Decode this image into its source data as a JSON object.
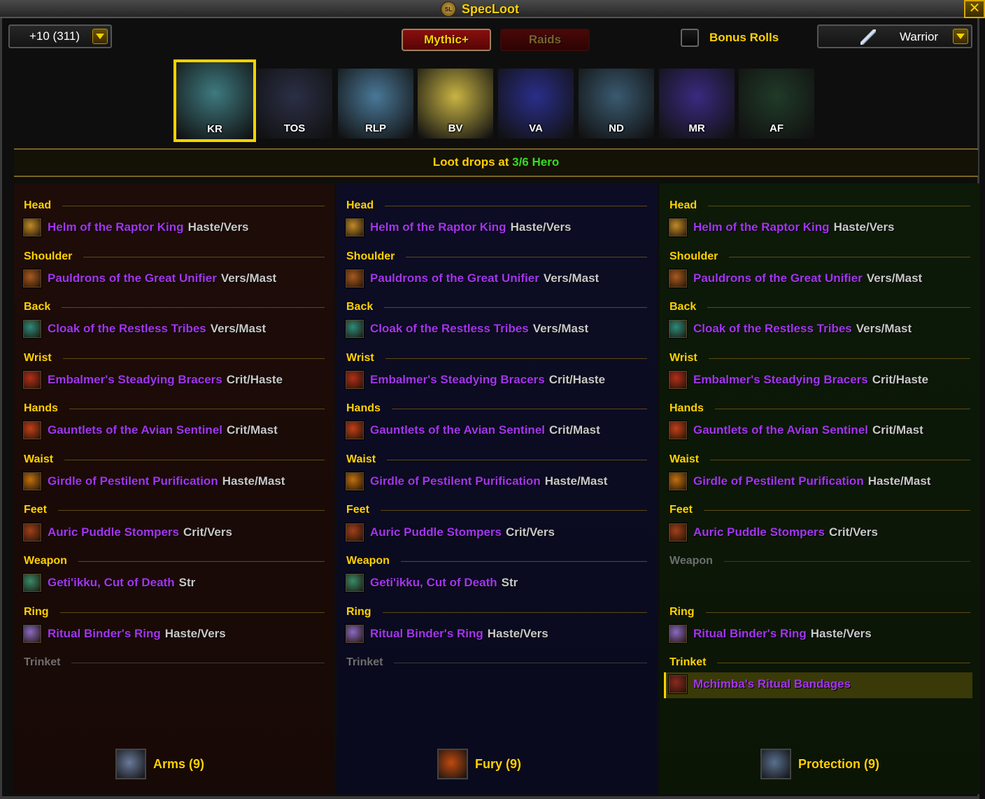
{
  "title": "SpecLoot",
  "title_icon_text": "SL",
  "close_label": "✕",
  "keystone_dropdown": {
    "value": "+10 (311)"
  },
  "tabs": [
    {
      "label": "Mythic+",
      "active": true
    },
    {
      "label": "Raids",
      "active": false
    }
  ],
  "bonus_rolls": {
    "label": "Bonus Rolls",
    "checked": false
  },
  "class_dropdown": {
    "value": "Warrior",
    "icon": "sword-icon"
  },
  "dungeons": [
    {
      "abbr": "KR",
      "selected": true,
      "color": "#3e7a80"
    },
    {
      "abbr": "TOS",
      "selected": false,
      "color": "#2b2f46"
    },
    {
      "abbr": "RLP",
      "selected": false,
      "color": "#4a7898"
    },
    {
      "abbr": "BV",
      "selected": false,
      "color": "#c9b443"
    },
    {
      "abbr": "VA",
      "selected": false,
      "color": "#2a2e8a"
    },
    {
      "abbr": "ND",
      "selected": false,
      "color": "#3a5a70"
    },
    {
      "abbr": "MR",
      "selected": false,
      "color": "#3a2a80"
    },
    {
      "abbr": "AF",
      "selected": false,
      "color": "#203a28"
    }
  ],
  "loot_drops": {
    "prefix": "Loot drops at",
    "level": "3/6 Hero"
  },
  "slot_labels": [
    "Head",
    "Shoulder",
    "Back",
    "Wrist",
    "Hands",
    "Waist",
    "Feet",
    "Weapon",
    "Ring",
    "Trinket"
  ],
  "items": [
    {
      "name": "Helm of the Raptor King",
      "stats": "Haste/Vers",
      "icon": "helm-icon",
      "color": "#c08a2a"
    },
    {
      "name": "Pauldrons of the Great Unifier",
      "stats": "Vers/Mast",
      "icon": "pauldrons-icon",
      "color": "#a85a20"
    },
    {
      "name": "Cloak of the Restless Tribes",
      "stats": "Vers/Mast",
      "icon": "cloak-icon",
      "color": "#2e8a7a"
    },
    {
      "name": "Embalmer's Steadying Bracers",
      "stats": "Crit/Haste",
      "icon": "bracers-icon",
      "color": "#b0301a"
    },
    {
      "name": "Gauntlets of the Avian Sentinel",
      "stats": "Crit/Mast",
      "icon": "gauntlets-icon",
      "color": "#c0401a"
    },
    {
      "name": "Girdle of Pestilent Purification",
      "stats": "Haste/Mast",
      "icon": "girdle-icon",
      "color": "#c07010"
    },
    {
      "name": "Auric Puddle Stompers",
      "stats": "Crit/Vers",
      "icon": "boots-icon",
      "color": "#a0401a"
    },
    {
      "name": "Geti'ikku, Cut of Death",
      "stats": "Str",
      "icon": "weapon-icon",
      "color": "#3a8a6a"
    },
    {
      "name": "Ritual Binder's Ring",
      "stats": "Haste/Vers",
      "icon": "ring-icon",
      "color": "#8a6ac0"
    },
    {
      "name": "Mchimba's Ritual Bandages",
      "stats": "",
      "icon": "bandages-icon",
      "color": "#8a2a20"
    }
  ],
  "specs": [
    {
      "name": "Arms",
      "label": "Arms (9)",
      "icon": "arms-icon",
      "accent": "#6a7a9a"
    },
    {
      "name": "Fury",
      "label": "Fury (9)",
      "icon": "fury-icon",
      "accent": "#c04a10"
    },
    {
      "name": "Protection",
      "label": "Protection (9)",
      "icon": "protection-icon",
      "accent": "#5a7090"
    }
  ],
  "colors": {
    "gold": "#ffd100",
    "epic_purple": "#a335ee",
    "stat_gray": "#c8c8c8",
    "hero_green": "#33dd22"
  }
}
